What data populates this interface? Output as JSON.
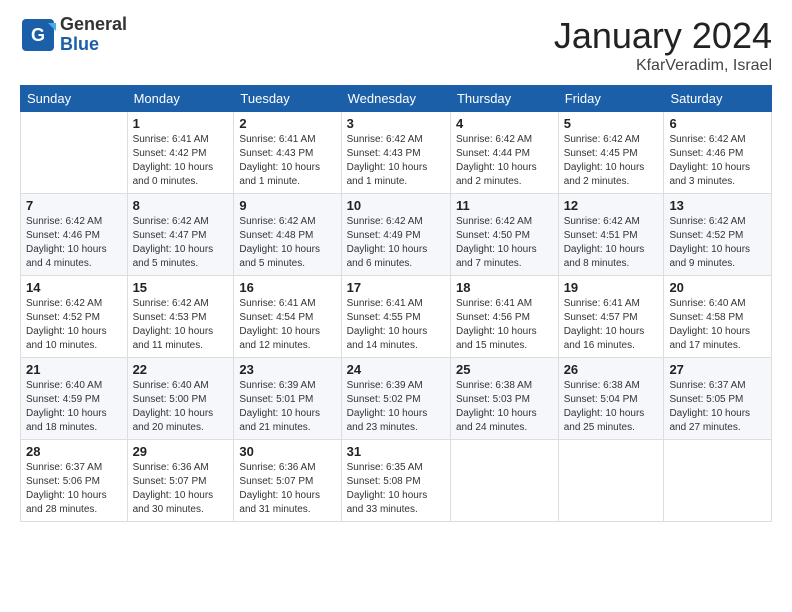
{
  "header": {
    "logo": {
      "general": "General",
      "blue": "Blue"
    },
    "title": "January 2024",
    "location": "KfarVeradim, Israel"
  },
  "days_of_week": [
    "Sunday",
    "Monday",
    "Tuesday",
    "Wednesday",
    "Thursday",
    "Friday",
    "Saturday"
  ],
  "weeks": [
    [
      {
        "day": "",
        "sunrise": "",
        "sunset": "",
        "daylight": ""
      },
      {
        "day": "1",
        "sunrise": "Sunrise: 6:41 AM",
        "sunset": "Sunset: 4:42 PM",
        "daylight": "Daylight: 10 hours and 0 minutes."
      },
      {
        "day": "2",
        "sunrise": "Sunrise: 6:41 AM",
        "sunset": "Sunset: 4:43 PM",
        "daylight": "Daylight: 10 hours and 1 minute."
      },
      {
        "day": "3",
        "sunrise": "Sunrise: 6:42 AM",
        "sunset": "Sunset: 4:43 PM",
        "daylight": "Daylight: 10 hours and 1 minute."
      },
      {
        "day": "4",
        "sunrise": "Sunrise: 6:42 AM",
        "sunset": "Sunset: 4:44 PM",
        "daylight": "Daylight: 10 hours and 2 minutes."
      },
      {
        "day": "5",
        "sunrise": "Sunrise: 6:42 AM",
        "sunset": "Sunset: 4:45 PM",
        "daylight": "Daylight: 10 hours and 2 minutes."
      },
      {
        "day": "6",
        "sunrise": "Sunrise: 6:42 AM",
        "sunset": "Sunset: 4:46 PM",
        "daylight": "Daylight: 10 hours and 3 minutes."
      }
    ],
    [
      {
        "day": "7",
        "sunrise": "Sunrise: 6:42 AM",
        "sunset": "Sunset: 4:46 PM",
        "daylight": "Daylight: 10 hours and 4 minutes."
      },
      {
        "day": "8",
        "sunrise": "Sunrise: 6:42 AM",
        "sunset": "Sunset: 4:47 PM",
        "daylight": "Daylight: 10 hours and 5 minutes."
      },
      {
        "day": "9",
        "sunrise": "Sunrise: 6:42 AM",
        "sunset": "Sunset: 4:48 PM",
        "daylight": "Daylight: 10 hours and 5 minutes."
      },
      {
        "day": "10",
        "sunrise": "Sunrise: 6:42 AM",
        "sunset": "Sunset: 4:49 PM",
        "daylight": "Daylight: 10 hours and 6 minutes."
      },
      {
        "day": "11",
        "sunrise": "Sunrise: 6:42 AM",
        "sunset": "Sunset: 4:50 PM",
        "daylight": "Daylight: 10 hours and 7 minutes."
      },
      {
        "day": "12",
        "sunrise": "Sunrise: 6:42 AM",
        "sunset": "Sunset: 4:51 PM",
        "daylight": "Daylight: 10 hours and 8 minutes."
      },
      {
        "day": "13",
        "sunrise": "Sunrise: 6:42 AM",
        "sunset": "Sunset: 4:52 PM",
        "daylight": "Daylight: 10 hours and 9 minutes."
      }
    ],
    [
      {
        "day": "14",
        "sunrise": "Sunrise: 6:42 AM",
        "sunset": "Sunset: 4:52 PM",
        "daylight": "Daylight: 10 hours and 10 minutes."
      },
      {
        "day": "15",
        "sunrise": "Sunrise: 6:42 AM",
        "sunset": "Sunset: 4:53 PM",
        "daylight": "Daylight: 10 hours and 11 minutes."
      },
      {
        "day": "16",
        "sunrise": "Sunrise: 6:41 AM",
        "sunset": "Sunset: 4:54 PM",
        "daylight": "Daylight: 10 hours and 12 minutes."
      },
      {
        "day": "17",
        "sunrise": "Sunrise: 6:41 AM",
        "sunset": "Sunset: 4:55 PM",
        "daylight": "Daylight: 10 hours and 14 minutes."
      },
      {
        "day": "18",
        "sunrise": "Sunrise: 6:41 AM",
        "sunset": "Sunset: 4:56 PM",
        "daylight": "Daylight: 10 hours and 15 minutes."
      },
      {
        "day": "19",
        "sunrise": "Sunrise: 6:41 AM",
        "sunset": "Sunset: 4:57 PM",
        "daylight": "Daylight: 10 hours and 16 minutes."
      },
      {
        "day": "20",
        "sunrise": "Sunrise: 6:40 AM",
        "sunset": "Sunset: 4:58 PM",
        "daylight": "Daylight: 10 hours and 17 minutes."
      }
    ],
    [
      {
        "day": "21",
        "sunrise": "Sunrise: 6:40 AM",
        "sunset": "Sunset: 4:59 PM",
        "daylight": "Daylight: 10 hours and 18 minutes."
      },
      {
        "day": "22",
        "sunrise": "Sunrise: 6:40 AM",
        "sunset": "Sunset: 5:00 PM",
        "daylight": "Daylight: 10 hours and 20 minutes."
      },
      {
        "day": "23",
        "sunrise": "Sunrise: 6:39 AM",
        "sunset": "Sunset: 5:01 PM",
        "daylight": "Daylight: 10 hours and 21 minutes."
      },
      {
        "day": "24",
        "sunrise": "Sunrise: 6:39 AM",
        "sunset": "Sunset: 5:02 PM",
        "daylight": "Daylight: 10 hours and 23 minutes."
      },
      {
        "day": "25",
        "sunrise": "Sunrise: 6:38 AM",
        "sunset": "Sunset: 5:03 PM",
        "daylight": "Daylight: 10 hours and 24 minutes."
      },
      {
        "day": "26",
        "sunrise": "Sunrise: 6:38 AM",
        "sunset": "Sunset: 5:04 PM",
        "daylight": "Daylight: 10 hours and 25 minutes."
      },
      {
        "day": "27",
        "sunrise": "Sunrise: 6:37 AM",
        "sunset": "Sunset: 5:05 PM",
        "daylight": "Daylight: 10 hours and 27 minutes."
      }
    ],
    [
      {
        "day": "28",
        "sunrise": "Sunrise: 6:37 AM",
        "sunset": "Sunset: 5:06 PM",
        "daylight": "Daylight: 10 hours and 28 minutes."
      },
      {
        "day": "29",
        "sunrise": "Sunrise: 6:36 AM",
        "sunset": "Sunset: 5:07 PM",
        "daylight": "Daylight: 10 hours and 30 minutes."
      },
      {
        "day": "30",
        "sunrise": "Sunrise: 6:36 AM",
        "sunset": "Sunset: 5:07 PM",
        "daylight": "Daylight: 10 hours and 31 minutes."
      },
      {
        "day": "31",
        "sunrise": "Sunrise: 6:35 AM",
        "sunset": "Sunset: 5:08 PM",
        "daylight": "Daylight: 10 hours and 33 minutes."
      },
      {
        "day": "",
        "sunrise": "",
        "sunset": "",
        "daylight": ""
      },
      {
        "day": "",
        "sunrise": "",
        "sunset": "",
        "daylight": ""
      },
      {
        "day": "",
        "sunrise": "",
        "sunset": "",
        "daylight": ""
      }
    ]
  ]
}
